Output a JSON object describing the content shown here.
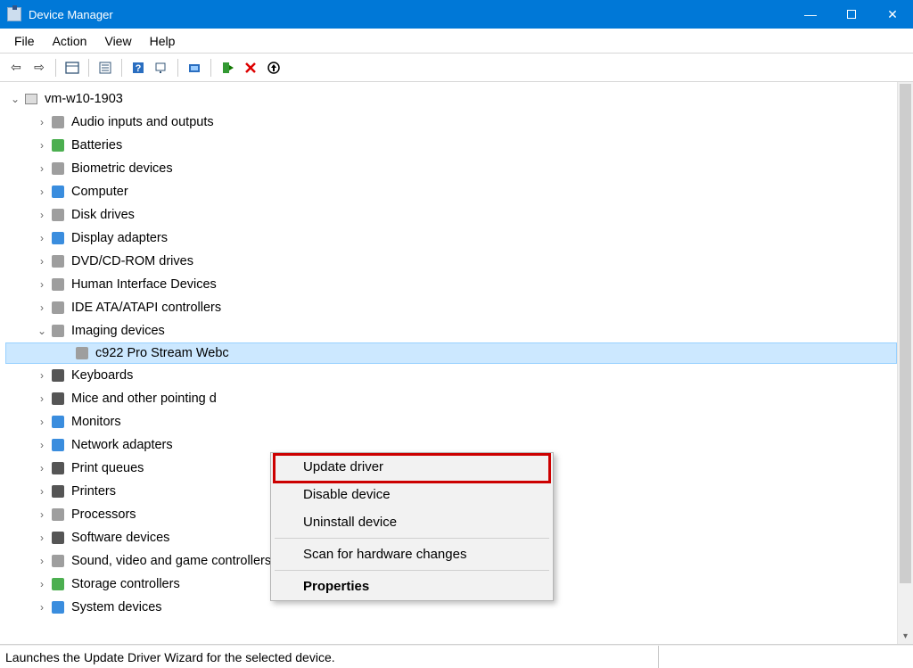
{
  "window": {
    "title": "Device Manager"
  },
  "menu": {
    "file": "File",
    "action": "Action",
    "view": "View",
    "help": "Help"
  },
  "tree": {
    "root": "vm-w10-1903",
    "items": [
      {
        "label": "Audio inputs and outputs"
      },
      {
        "label": "Batteries"
      },
      {
        "label": "Biometric devices"
      },
      {
        "label": "Computer"
      },
      {
        "label": "Disk drives"
      },
      {
        "label": "Display adapters"
      },
      {
        "label": "DVD/CD-ROM drives"
      },
      {
        "label": "Human Interface Devices"
      },
      {
        "label": "IDE ATA/ATAPI controllers"
      },
      {
        "label": "Imaging devices",
        "expanded": true
      },
      {
        "label": "Keyboards"
      },
      {
        "label": "Mice and other pointing d"
      },
      {
        "label": "Monitors"
      },
      {
        "label": "Network adapters"
      },
      {
        "label": "Print queues"
      },
      {
        "label": "Printers"
      },
      {
        "label": "Processors"
      },
      {
        "label": "Software devices"
      },
      {
        "label": "Sound, video and game controllers"
      },
      {
        "label": "Storage controllers"
      },
      {
        "label": "System devices"
      }
    ],
    "selected_child": "c922 Pro Stream Webc"
  },
  "context_menu": {
    "update": "Update driver",
    "disable": "Disable device",
    "uninstall": "Uninstall device",
    "scan": "Scan for hardware changes",
    "properties": "Properties"
  },
  "status": "Launches the Update Driver Wizard for the selected device."
}
